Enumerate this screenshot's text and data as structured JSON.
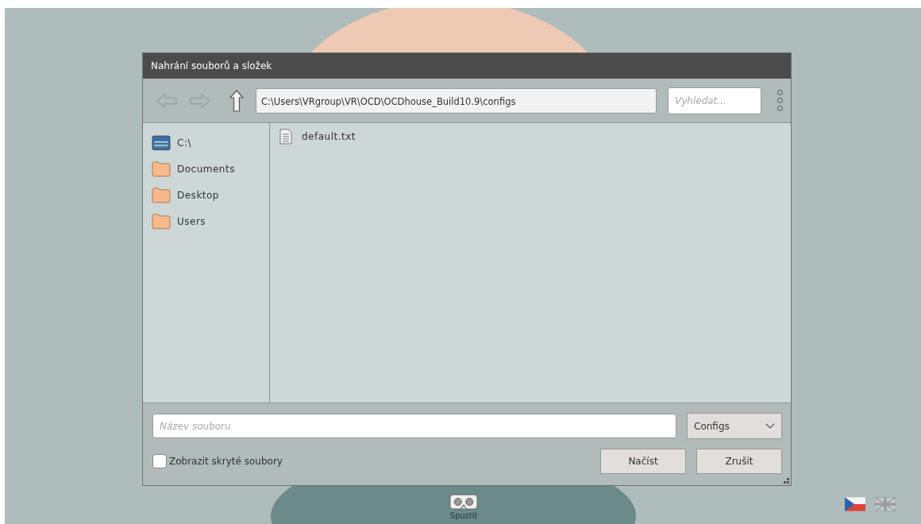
{
  "dialog": {
    "title": "Nahrání souborů a složek",
    "toolbar": {
      "nav": [
        {
          "kind": "back",
          "disabled": true
        },
        {
          "kind": "forward",
          "disabled": true
        },
        {
          "kind": "up",
          "disabled": false
        }
      ],
      "path": "C:\\Users\\VRgroup\\VR\\OCD\\OCDhouse_Build10.9\\configs",
      "search": {
        "placeholder": "Vyhledat..."
      }
    },
    "sidebar": {
      "items": [
        {
          "kind": "drive",
          "label": "C:\\"
        },
        {
          "kind": "folder",
          "label": "Documents"
        },
        {
          "kind": "folder",
          "label": "Desktop"
        },
        {
          "kind": "folder",
          "label": "Users"
        }
      ]
    },
    "files": [
      {
        "kind": "text",
        "name": "default.txt"
      }
    ],
    "filename": {
      "placeholder": "Název souboru"
    },
    "filter": {
      "value": "Configs"
    },
    "show_hidden": {
      "label": "Zobrazit skryté soubory",
      "checked": false
    },
    "buttons": [
      "Načíst",
      "Zrušit"
    ]
  },
  "launch": {
    "label": "Spustit"
  },
  "languages": [
    {
      "kind": "cz",
      "selected": true
    },
    {
      "kind": "uk",
      "selected": false
    }
  ]
}
